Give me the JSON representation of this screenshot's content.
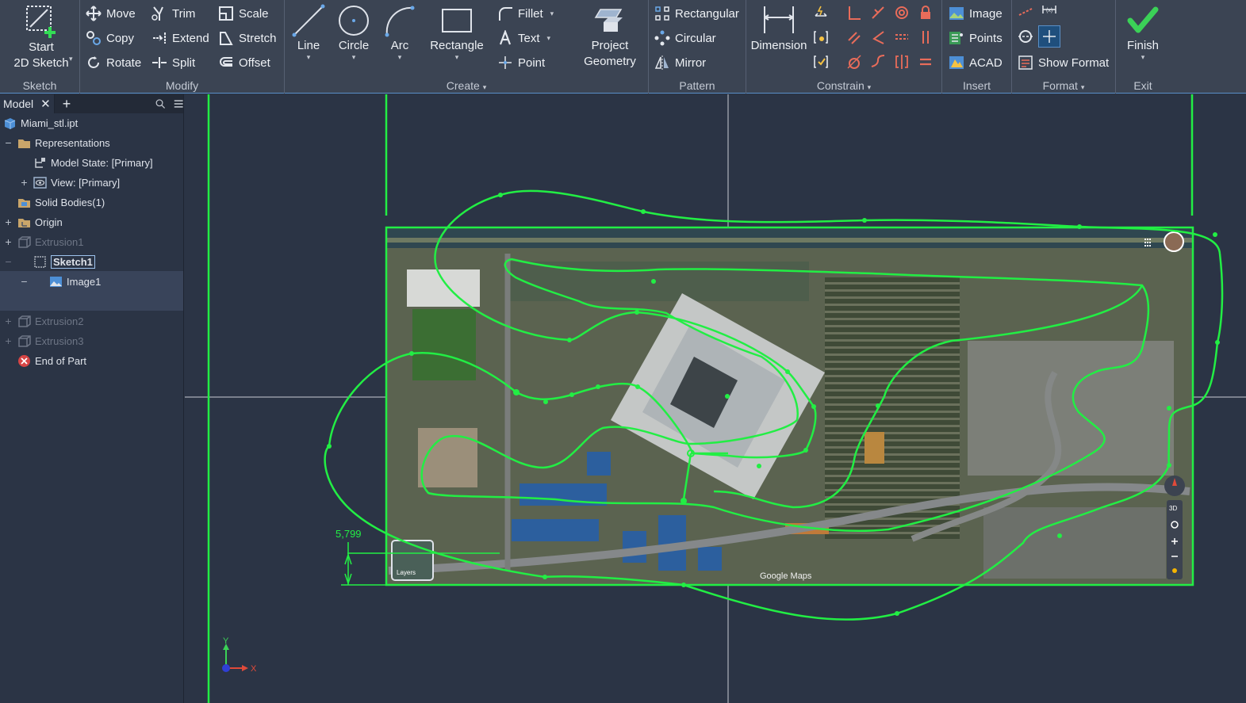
{
  "ribbon": {
    "sketch": {
      "start_label": "Start\n2D Sketch",
      "title": "Sketch"
    },
    "modify": {
      "title": "Modify",
      "items": [
        "Move",
        "Copy",
        "Rotate",
        "Trim",
        "Extend",
        "Split",
        "Scale",
        "Stretch",
        "Offset"
      ]
    },
    "create": {
      "title": "Create",
      "line": "Line",
      "circle": "Circle",
      "arc": "Arc",
      "rectangle": "Rectangle",
      "fillet": "Fillet",
      "text": "Text",
      "point": "Point",
      "project": "Project\nGeometry"
    },
    "pattern": {
      "title": "Pattern",
      "rectangular": "Rectangular",
      "circular": "Circular",
      "mirror": "Mirror"
    },
    "constrain": {
      "title": "Constrain",
      "dimension": "Dimension"
    },
    "insert": {
      "title": "Insert",
      "image": "Image",
      "points": "Points",
      "acad": "ACAD"
    },
    "format": {
      "title": "Format",
      "show_format": "Show Format"
    },
    "exit": {
      "title": "Exit",
      "finish": "Finish"
    }
  },
  "browser": {
    "tab_label": "Model",
    "tree": [
      {
        "label": "Miami_stl.ipt",
        "dim": false
      },
      {
        "label": "Representations",
        "dim": false
      },
      {
        "label": "Model State: [Primary]",
        "dim": false
      },
      {
        "label": "View: [Primary]",
        "dim": false
      },
      {
        "label": "Solid Bodies(1)",
        "dim": false
      },
      {
        "label": "Origin",
        "dim": false
      },
      {
        "label": "Extrusion1",
        "dim": true
      },
      {
        "label": "Sketch1",
        "dim": false
      },
      {
        "label": "Image1",
        "dim": false
      },
      {
        "label": "Extrusion2",
        "dim": true
      },
      {
        "label": "Extrusion3",
        "dim": true
      },
      {
        "label": "End of Part",
        "dim": false
      }
    ]
  },
  "canvas": {
    "dimension_value": "5,799",
    "map_watermark": "Google Maps",
    "layers_label": "Layers",
    "axis_y": "Y",
    "axis_x": "X",
    "nav_3d": "3D"
  },
  "colors": {
    "sketch_green": "#22ee44",
    "ribbon_bg": "#3b4453",
    "canvas_bg": "#2b3445",
    "accent": "#5a8fc7"
  }
}
